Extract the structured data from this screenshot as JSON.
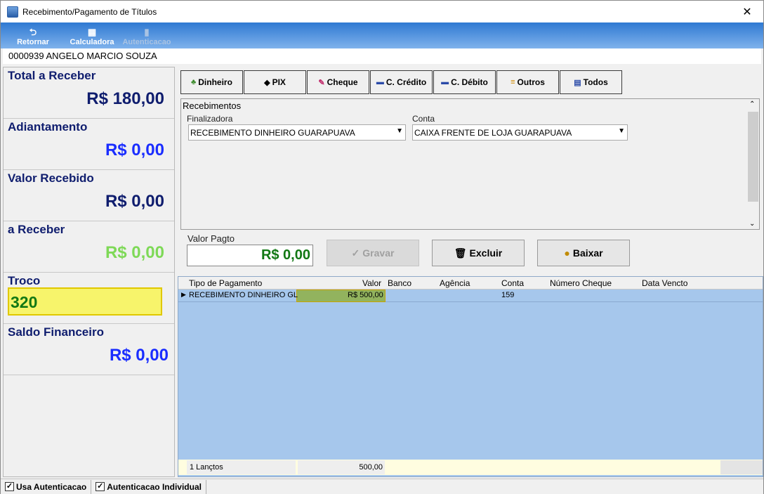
{
  "window": {
    "title": "Recebimento/Pagamento de Títulos",
    "close_glyph": "✕"
  },
  "toolbar": {
    "retornar": "Retornar",
    "calculadora": "Calculadora",
    "autenticacao": "Autenticacao"
  },
  "client": {
    "name": "0000939 ANGELO MARCIO SOUZA"
  },
  "left": {
    "total_label": "Total a Receber",
    "total_value": "R$ 180,00",
    "adiant_label": "Adiantamento",
    "adiant_value": "R$ 0,00",
    "recebido_label": "Valor Recebido",
    "recebido_value": "R$ 0,00",
    "areceber_label": "a Receber",
    "areceber_value": "R$ 0,00",
    "troco_label": "Troco",
    "troco_value": "320",
    "saldo_label": "Saldo Financeiro",
    "saldo_value": "R$ 0,00",
    "colors": {
      "total": "#0f1d6e",
      "adiant": "#1a2dff",
      "recebido": "#0f1d6e",
      "areceber": "#7ed957",
      "saldo": "#1a2dff"
    }
  },
  "tabs": [
    {
      "label": "Dinheiro",
      "icon": "money-icon"
    },
    {
      "label": "PIX",
      "icon": "pix-icon"
    },
    {
      "label": "Cheque",
      "icon": "cheque-icon"
    },
    {
      "label": "C. Crédito",
      "icon": "credit-card-icon"
    },
    {
      "label": "C. Débito",
      "icon": "debit-card-icon"
    },
    {
      "label": "Outros",
      "icon": "others-icon"
    },
    {
      "label": "Todos",
      "icon": "all-icon"
    }
  ],
  "recebimentos": {
    "heading": "Recebimentos",
    "finalizadora_label": "Finalizadora",
    "finalizadora_value": "RECEBIMENTO DINHEIRO GUARAPUAVA",
    "conta_label": "Conta",
    "conta_value": "CAIXA FRENTE DE LOJA GUARAPUAVA"
  },
  "valor_pagto": {
    "label": "Valor Pagto",
    "value": "R$ 0,00"
  },
  "actions": {
    "gravar": "Gravar",
    "excluir": "Excluir",
    "baixar": "Baixar"
  },
  "grid": {
    "headers": [
      "Tipo de Pagamento",
      "Valor",
      "Banco",
      "Agência",
      "Conta",
      "Número Cheque",
      "Data Vencto"
    ],
    "rows": [
      [
        "RECEBIMENTO DINHEIRO GL",
        "R$ 500,00",
        "",
        "",
        "159",
        "",
        ""
      ]
    ],
    "footer": {
      "count": "1 Lançtos",
      "total": "500,00"
    }
  },
  "status": {
    "usa_autenticacao": "Usa Autenticacao",
    "autenticacao_individual": "Autenticacao Individual"
  }
}
